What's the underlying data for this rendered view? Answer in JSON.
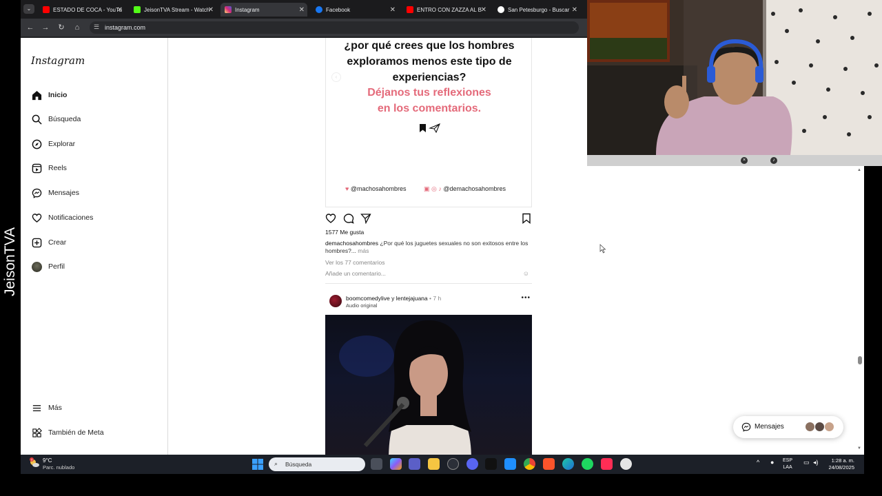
{
  "stream": {
    "streamer_name": "JeisonTVA"
  },
  "browser": {
    "tabs": [
      {
        "label": "ESTADO DE COCA - YouTube",
        "favicon_color": "#ff0000",
        "active": false
      },
      {
        "label": "JeisonTVA Stream - Watch",
        "favicon_color": "#53fc18",
        "active": false
      },
      {
        "label": "Instagram",
        "favicon_color": "#d62976",
        "active": true
      },
      {
        "label": "Facebook",
        "favicon_color": "#1877f2",
        "active": false
      },
      {
        "label": "ENTRO CON ZAZZA AL B",
        "favicon_color": "#ff0000",
        "active": false
      },
      {
        "label": "San Petesburgo - Buscar",
        "favicon_color": "#ffffff",
        "active": false
      }
    ],
    "url": "instagram.com"
  },
  "instagram": {
    "logo": "Instagram",
    "nav": [
      {
        "label": "Inicio",
        "icon": "home-icon"
      },
      {
        "label": "Búsqueda",
        "icon": "search-icon"
      },
      {
        "label": "Explorar",
        "icon": "compass-icon"
      },
      {
        "label": "Reels",
        "icon": "reels-icon"
      },
      {
        "label": "Mensajes",
        "icon": "messenger-icon"
      },
      {
        "label": "Notificaciones",
        "icon": "heart-icon"
      },
      {
        "label": "Crear",
        "icon": "plus-square-icon"
      },
      {
        "label": "Perfil",
        "icon": "avatar-icon"
      }
    ],
    "more": "Más",
    "meta": "También de Meta",
    "post1": {
      "image_text_question": "¿por qué crees que los hombres exploramos menos este tipo de experiencias?",
      "image_text_cta": "Déjanos tus reflexiones en los comentarios.",
      "handle_twitter": "@machosahombres",
      "handle_social": "@demachosahombres",
      "likes": "1577 Me gusta",
      "caption_user": "demachosahombres",
      "caption_text": "¿Por qué los juguetes sexuales no son exitosos entre los hombres?...",
      "caption_more": "más",
      "view_comments": "Ver los 77 comentarios",
      "add_comment_placeholder": "Añade un comentario..."
    },
    "post2": {
      "user1": "boomcomedylive",
      "joiner": "y",
      "user2": "lentejajuana",
      "time": "• 7 h",
      "audio": "Audio original",
      "more": "•••"
    }
  },
  "messages_pill": {
    "label": "Mensajes"
  },
  "taskbar": {
    "weather_temp": "9°C",
    "weather_desc": "Parc. nublado",
    "weather_badge": "3",
    "search_placeholder": "Búsqueda",
    "lang_top": "ESP",
    "lang_bottom": "LAA",
    "time": "1:28 a. m.",
    "date": "24/08/2025"
  },
  "colors": {
    "ig_pink": "#e46a7a",
    "taskbar_bg": "#1c2028",
    "browser_bg": "#35363a"
  }
}
